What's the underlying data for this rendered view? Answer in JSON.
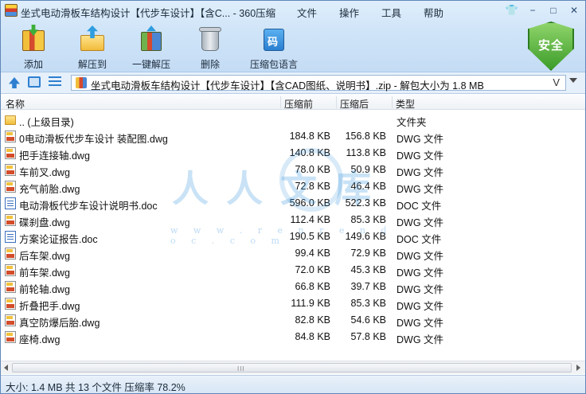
{
  "window": {
    "title": "坐式电动滑板车结构设计【代步车设计】【含C... - 360压缩",
    "menu": [
      "文件",
      "操作",
      "工具",
      "帮助"
    ],
    "buttons": {
      "shirt": "👕",
      "minimize": "−",
      "maximize": "□",
      "close": "✕"
    }
  },
  "toolbar": {
    "items": [
      {
        "label": "添加",
        "icon": "archive-add-icon"
      },
      {
        "label": "解压到",
        "icon": "extract-to-folder-icon"
      },
      {
        "label": "一键解压",
        "icon": "one-click-extract-icon"
      },
      {
        "label": "删除",
        "icon": "trash-bin-icon"
      },
      {
        "label": "压缩包语言",
        "icon": "archive-language-icon",
        "glyph": "码"
      }
    ],
    "security_label": "安全"
  },
  "address": {
    "path": "坐式电动滑板车结构设计【代步车设计】【含CAD图纸、说明书】.zip - 解包大小为 1.8 MB",
    "dropdown": "V"
  },
  "columns": {
    "name": "名称",
    "compressed": "压缩前",
    "original": "压缩后",
    "type": "类型"
  },
  "files": [
    {
      "name": ".. (上级目录)",
      "csize": "",
      "osize": "",
      "type": "文件夹",
      "kind": "folder"
    },
    {
      "name": "0电动滑板代步车设计 装配图.dwg",
      "csize": "184.8 KB",
      "osize": "156.8 KB",
      "type": "DWG 文件",
      "kind": "dwg"
    },
    {
      "name": "把手连接轴.dwg",
      "csize": "140.8 KB",
      "osize": "113.8 KB",
      "type": "DWG 文件",
      "kind": "dwg"
    },
    {
      "name": "车前叉.dwg",
      "csize": "78.0 KB",
      "osize": "50.9 KB",
      "type": "DWG 文件",
      "kind": "dwg"
    },
    {
      "name": "充气前胎.dwg",
      "csize": "72.8 KB",
      "osize": "46.4 KB",
      "type": "DWG 文件",
      "kind": "dwg"
    },
    {
      "name": "电动滑板代步车设计说明书.doc",
      "csize": "596.0 KB",
      "osize": "522.3 KB",
      "type": "DOC 文件",
      "kind": "doc"
    },
    {
      "name": "碟刹盘.dwg",
      "csize": "112.4 KB",
      "osize": "85.3 KB",
      "type": "DWG 文件",
      "kind": "dwg"
    },
    {
      "name": "方案论证报告.doc",
      "csize": "190.5 KB",
      "osize": "149.6 KB",
      "type": "DOC 文件",
      "kind": "doc"
    },
    {
      "name": "后车架.dwg",
      "csize": "99.4 KB",
      "osize": "72.9 KB",
      "type": "DWG 文件",
      "kind": "dwg"
    },
    {
      "name": "前车架.dwg",
      "csize": "72.0 KB",
      "osize": "45.3 KB",
      "type": "DWG 文件",
      "kind": "dwg"
    },
    {
      "name": "前轮轴.dwg",
      "csize": "66.8 KB",
      "osize": "39.7 KB",
      "type": "DWG 文件",
      "kind": "dwg"
    },
    {
      "name": "折叠把手.dwg",
      "csize": "111.9 KB",
      "osize": "85.3 KB",
      "type": "DWG 文件",
      "kind": "dwg"
    },
    {
      "name": "真空防爆后胎.dwg",
      "csize": "82.8 KB",
      "osize": "54.6 KB",
      "type": "DWG 文件",
      "kind": "dwg"
    },
    {
      "name": "座椅.dwg",
      "csize": "84.8 KB",
      "osize": "57.8 KB",
      "type": "DWG 文件",
      "kind": "dwg"
    }
  ],
  "watermark": {
    "main": "人人文库",
    "sub": "w w w . r e n r e n d o c . c o m"
  },
  "scrollbar": {
    "grip": "III"
  },
  "status": "大小: 1.4 MB 共 13 个文件 压缩率 78.2%"
}
